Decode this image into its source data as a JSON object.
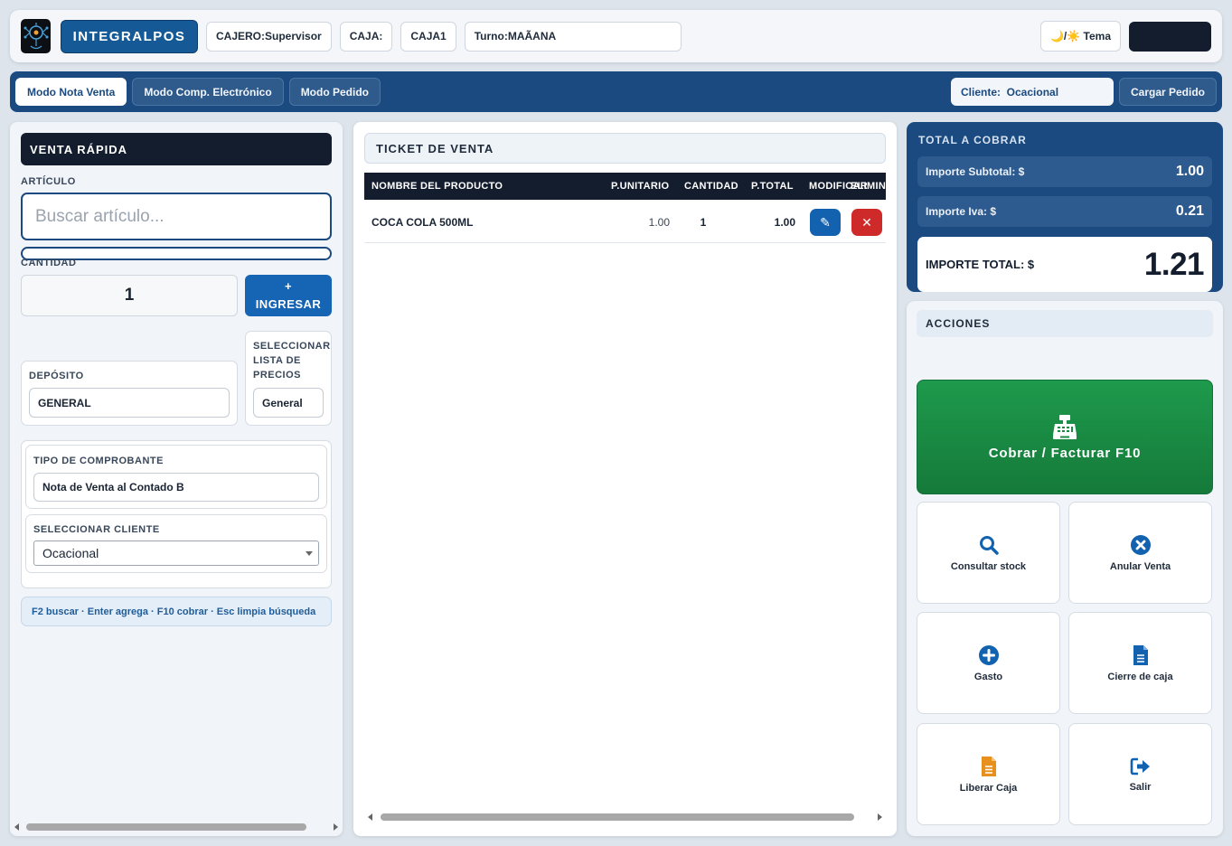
{
  "header": {
    "brand": "INTEGRALPOS",
    "cajero": "CAJERO:Supervisor",
    "caja_label": "CAJA:",
    "caja_value": "CAJA1",
    "turno": "Turno:MAÃANA",
    "theme_button": "🌙/☀️ Tema"
  },
  "modebar": {
    "modes": [
      "Modo Nota Venta",
      "Modo Comp. Electrónico",
      "Modo Pedido"
    ],
    "active_mode": "Modo Nota Venta",
    "client_chip": "Cliente:  Ocacional",
    "cargar_pedido": "Cargar Pedido"
  },
  "left": {
    "title": "VENTA RÁPIDA",
    "articulo_label": "ARTÍCULO",
    "search_placeholder": "Buscar artículo...",
    "cantidad_label": "CANTIDAD",
    "cantidad_value": "1",
    "ingresar_plus": "+",
    "ingresar_label": "INGRESAR",
    "deposito_label": "DEPÓSITO",
    "deposito_value": "GENERAL",
    "lista_label": "SELECCIONAR LISTA DE PRECIOS",
    "lista_value": "General",
    "tipo_label": "TIPO DE COMPROBANTE",
    "tipo_value": "Nota de Venta al Contado B",
    "cliente_label": "SELECCIONAR CLIENTE",
    "cliente_value": "Ocacional",
    "hint": "F2 buscar · Enter agrega · F10 cobrar · Esc limpia búsqueda"
  },
  "ticket": {
    "title": "TICKET DE VENTA",
    "columns": [
      "NOMBRE DEL PRODUCTO",
      "P.UNITARIO",
      "CANTIDAD",
      "P.TOTAL",
      "MODIFICAR",
      "ELIMINAR"
    ],
    "rows": [
      {
        "nombre": "COCA COLA 500ML",
        "unitario": "1.00",
        "cantidad": "1",
        "total": "1.00"
      }
    ],
    "edit_glyph": "✎",
    "delete_glyph": "✕"
  },
  "totals": {
    "title": "TOTAL A COBRAR",
    "subtotal_label": "Importe Subtotal: $",
    "subtotal_value": "1.00",
    "iva_label": "Importe Iva: $",
    "iva_value": "0.21",
    "total_label": "IMPORTE TOTAL: $",
    "total_value": "1.21"
  },
  "actions": {
    "title": "ACCIONES",
    "cobrar": "Cobrar / Facturar F10",
    "tiles": [
      {
        "label": "Consultar stock",
        "icon": "search-icon"
      },
      {
        "label": "Anular Venta",
        "icon": "cancel-circle-icon"
      },
      {
        "label": "Gasto",
        "icon": "plus-circle-icon"
      },
      {
        "label": "Cierre de caja",
        "icon": "document-icon"
      },
      {
        "label": "Liberar Caja",
        "icon": "document-icon"
      },
      {
        "label": "Salir",
        "icon": "sign-out-icon"
      }
    ]
  },
  "colors": {
    "primary": "#1a4a80",
    "dark": "#141d2e",
    "success": "#1e9a4c",
    "danger": "#cf2a2a",
    "accent_blue": "#1262b0",
    "accent_orange": "#e8901e"
  }
}
